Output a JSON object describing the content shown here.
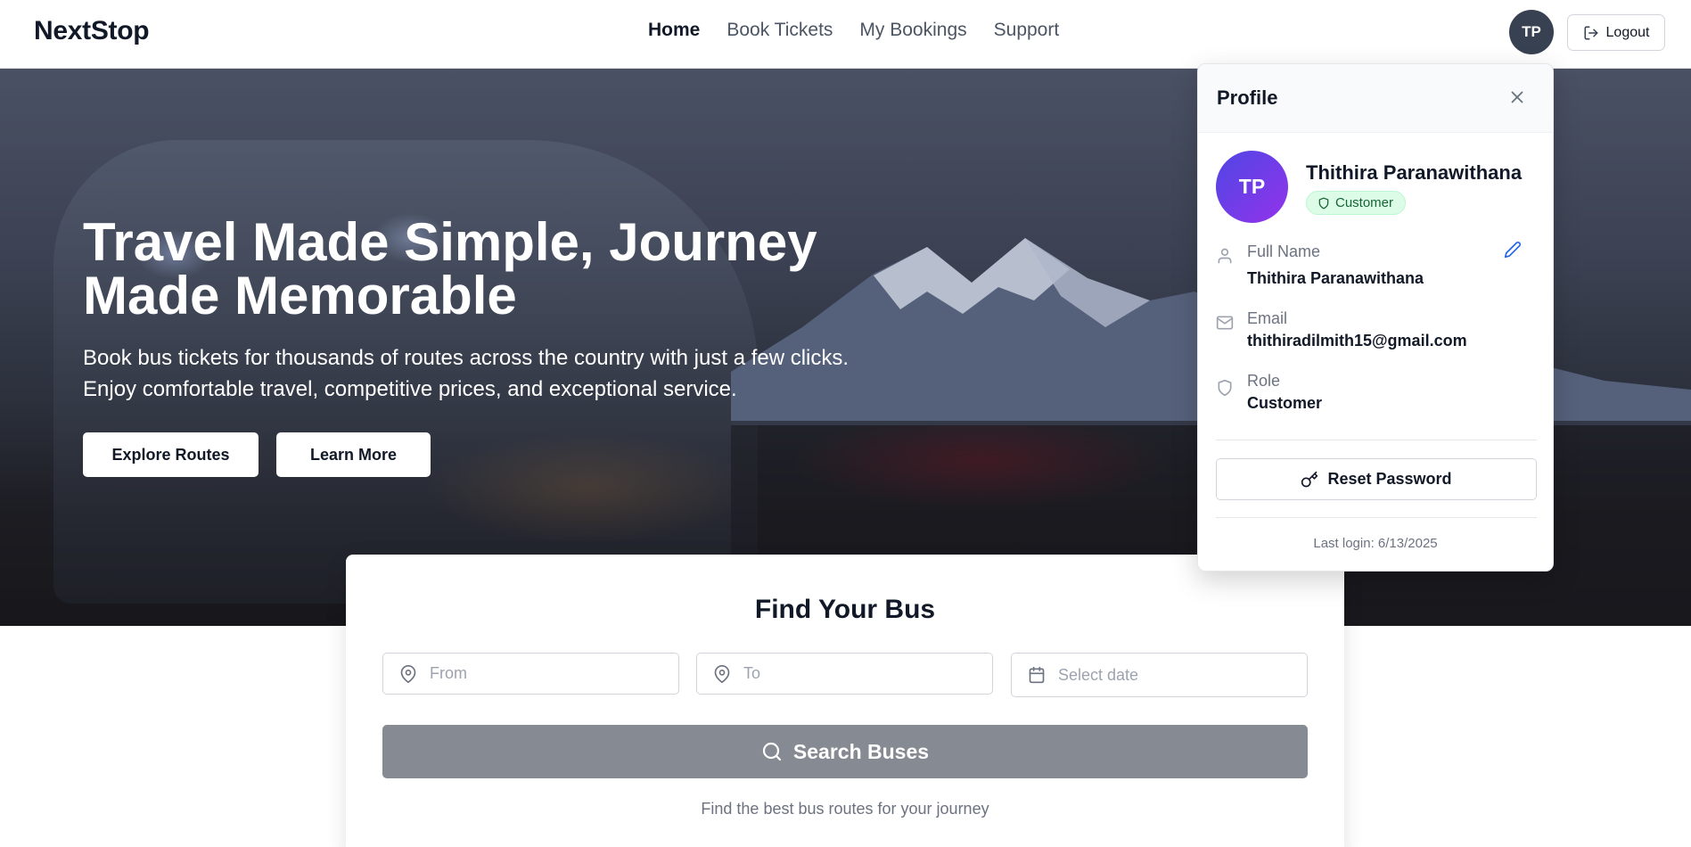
{
  "navbar": {
    "brand": "NextStop",
    "links": [
      {
        "label": "Home"
      },
      {
        "label": "Book Tickets"
      },
      {
        "label": "My Bookings"
      },
      {
        "label": "Support"
      }
    ],
    "avatar_initials": "TP",
    "logout_label": "Logout"
  },
  "hero": {
    "title": "Travel Made Simple, Journey Made Memorable",
    "subtitle": "Book bus tickets for thousands of routes across the country with just a few clicks. Enjoy comfortable travel, competitive prices, and exceptional service.",
    "explore_label": "Explore Routes",
    "learn_label": "Learn More"
  },
  "search": {
    "title": "Find Your Bus",
    "from_placeholder": "From",
    "to_placeholder": "To",
    "date_placeholder": "Select date",
    "button_label": "Search Buses",
    "hint": "Find the best bus routes for your journey"
  },
  "profile": {
    "title": "Profile",
    "initials": "TP",
    "name": "Thithira Paranawithana",
    "badge": "Customer",
    "full_name_label": "Full Name",
    "full_name_value": "Thithira Paranawithana",
    "email_label": "Email",
    "email_value": "thithiradilmith15@gmail.com",
    "role_label": "Role",
    "role_value": "Customer",
    "reset_label": "Reset Password",
    "last_login": "Last login: 6/13/2025"
  },
  "colors": {
    "avatar_dark": "#374151",
    "avatar_gradient_start": "#4f46e5",
    "avatar_gradient_end": "#9333ea",
    "badge_bg": "#dcfce7",
    "badge_text": "#166534",
    "search_button": "#868a93"
  },
  "icons": [
    "logout-icon",
    "map-pin-icon",
    "calendar-icon",
    "search-icon",
    "close-icon",
    "shield-icon",
    "user-icon",
    "mail-icon",
    "pencil-icon",
    "key-icon"
  ]
}
